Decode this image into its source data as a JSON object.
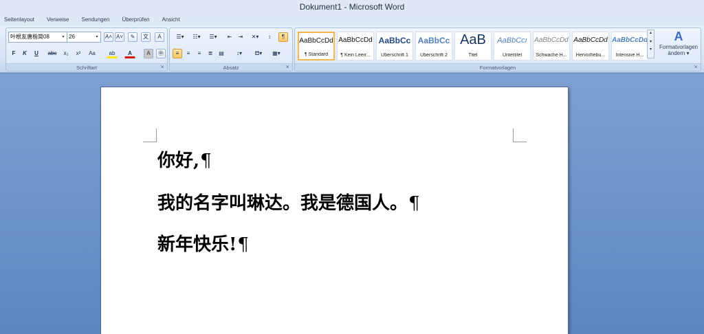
{
  "window": {
    "title": "Dokument1 - Microsoft Word"
  },
  "tabs": [
    "Seitenlayout",
    "Verweise",
    "Sendungen",
    "Überprüfen",
    "Ansicht"
  ],
  "ribbon": {
    "font": {
      "name": "叶根友唐楷简08",
      "size": "26",
      "group_label": "Schriftart",
      "buttons": {
        "bold": "F",
        "italic": "K",
        "underline": "U",
        "strike": "abc",
        "subscript": "x₂",
        "superscript": "x²",
        "case": "Aa",
        "grow": "A˄",
        "shrink": "A˅",
        "clear": "✎",
        "phonetic": "文",
        "border": "A",
        "highlight": "ab",
        "color": "A",
        "shading": "A",
        "enclose": "㊥"
      }
    },
    "paragraph": {
      "group_label": "Absatz",
      "show_marks": "¶"
    },
    "styles": {
      "group_label": "Formatvorlagen",
      "items": [
        {
          "sample": "AaBbCcDd",
          "name": "¶ Standard"
        },
        {
          "sample": "AaBbCcDd",
          "name": "¶ Kein Leerr..."
        },
        {
          "sample": "AaBbCc",
          "name": "Überschrift 1"
        },
        {
          "sample": "AaBbCc",
          "name": "Überschrift 2"
        },
        {
          "sample": "AaB",
          "name": "Titel"
        },
        {
          "sample": "AaBbCcı",
          "name": "Untertitel"
        },
        {
          "sample": "AaBbCcDd",
          "name": "Schwache H..."
        },
        {
          "sample": "AaBbCcDd",
          "name": "Hervorhebu..."
        },
        {
          "sample": "AaBbCcDd",
          "name": "Intensive H..."
        }
      ],
      "change_label_1": "Formatvorlagen",
      "change_label_2": "ändern ▾"
    }
  },
  "document": {
    "lines": [
      "你好,",
      "我的名字叫琳达。我是德国人。",
      "新年快乐!"
    ],
    "pilcrow": "¶"
  },
  "colors": {
    "selected_style_border": "#f2b64b",
    "accent": "#3b6bc6"
  }
}
